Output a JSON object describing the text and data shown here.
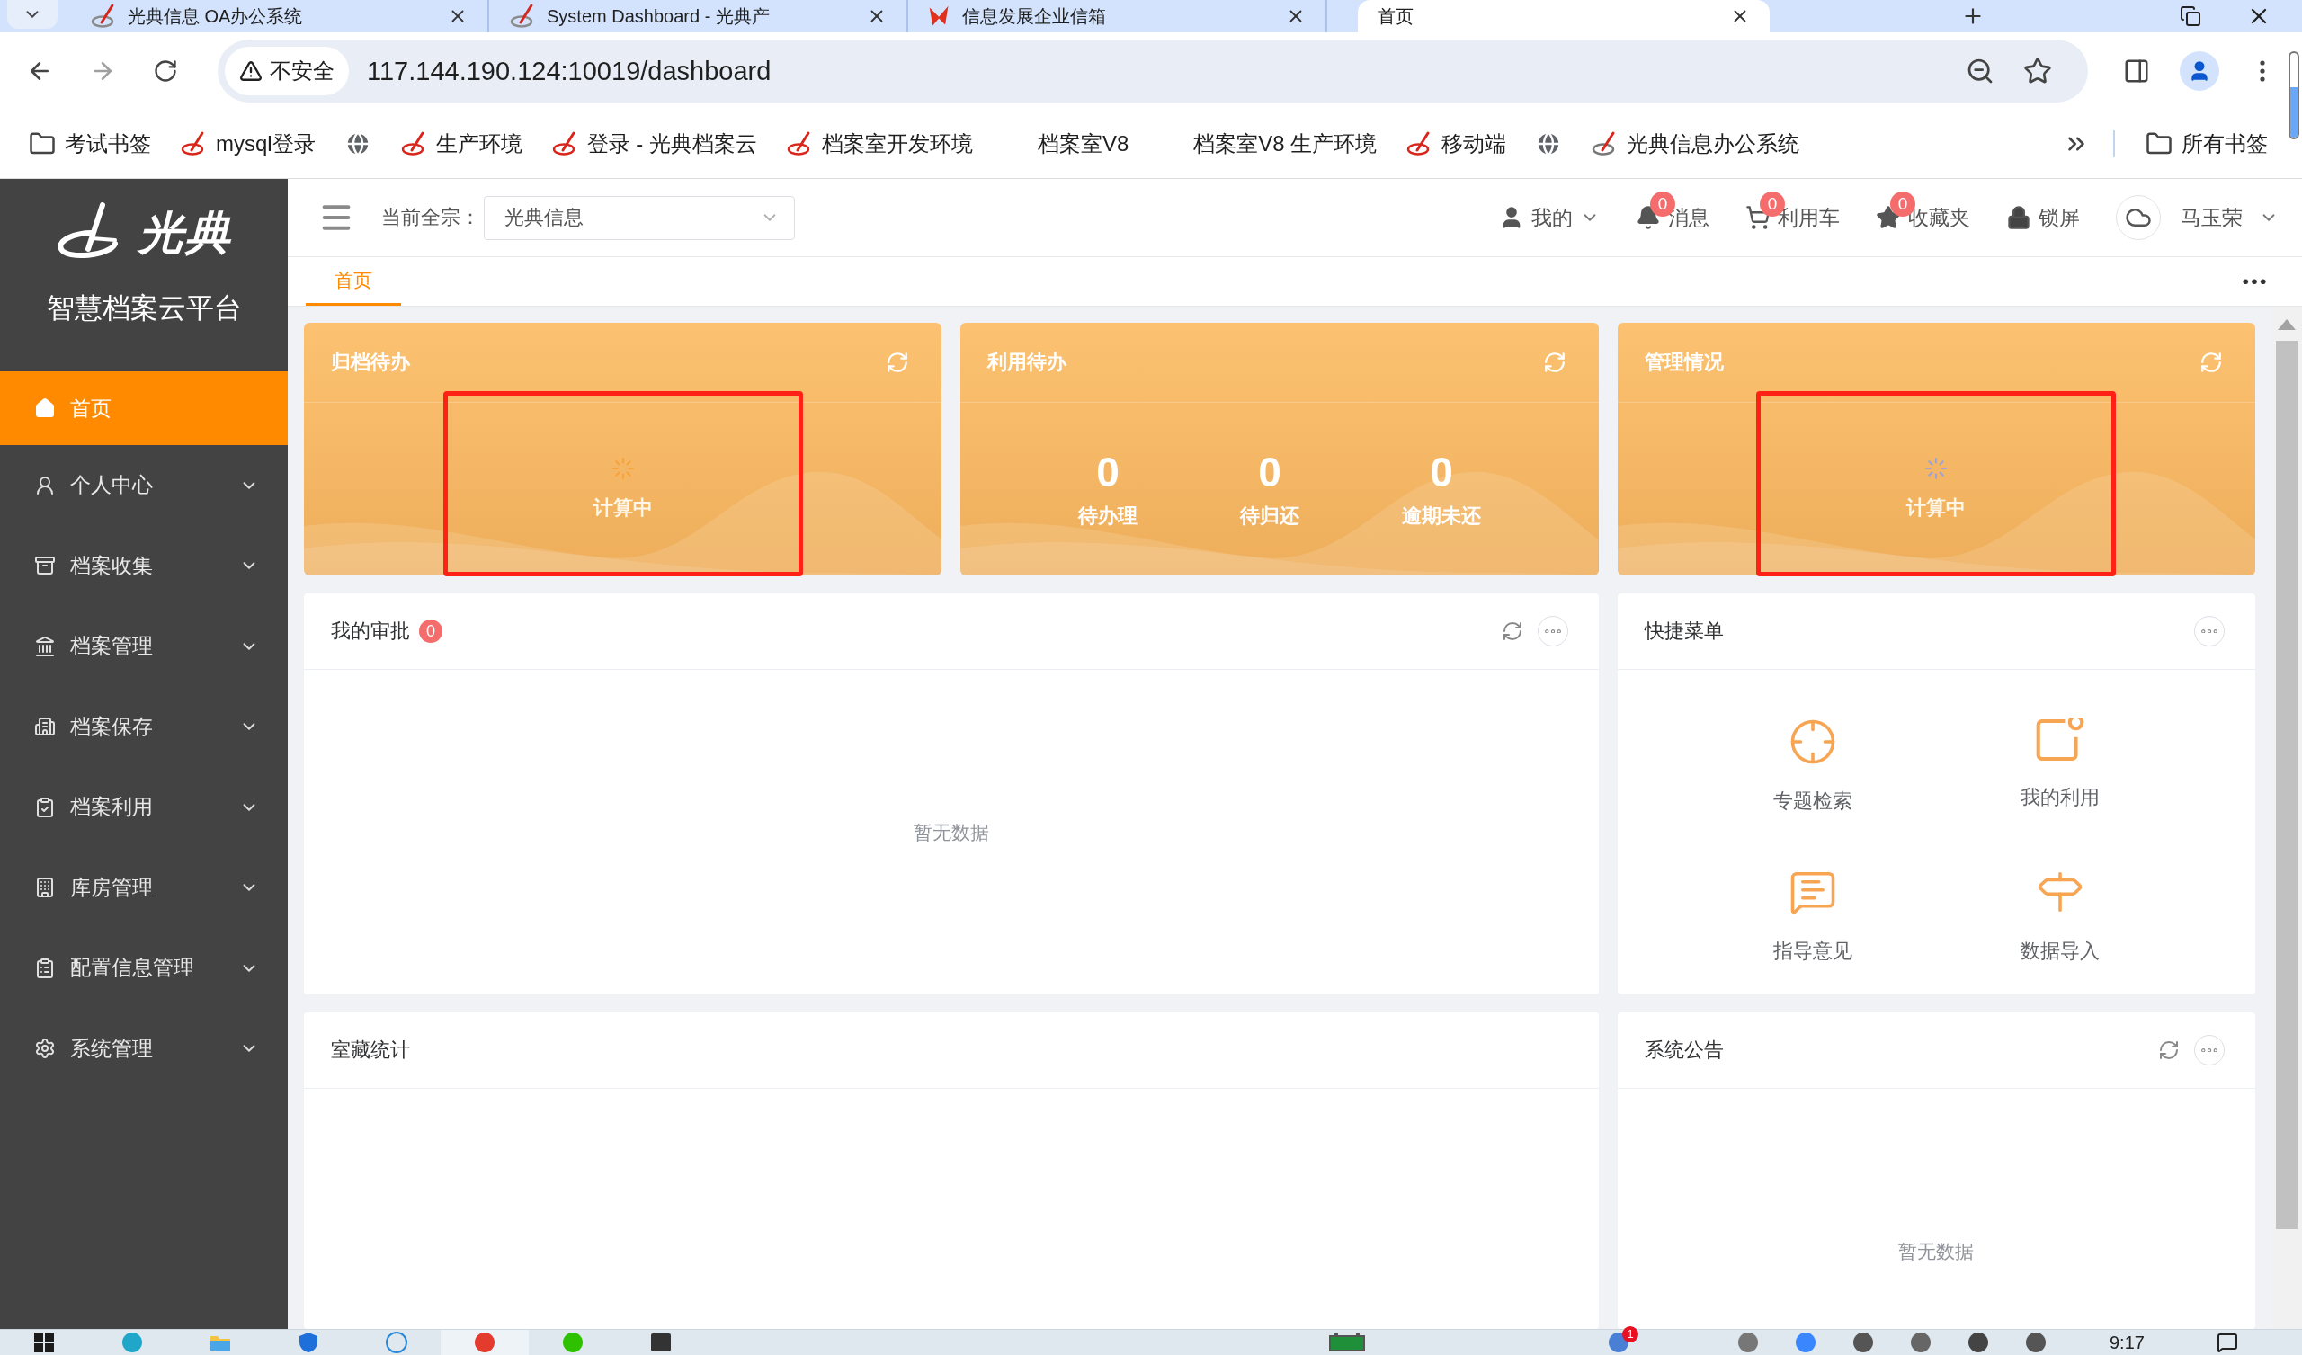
{
  "browser": {
    "tabs": [
      {
        "title": "光典信息 OA办公系统",
        "kind": "logo",
        "selected": false
      },
      {
        "title": "System Dashboard - 光典产",
        "kind": "logo",
        "selected": false
      },
      {
        "title": "信息发展企业信箱",
        "kind": "mark",
        "selected": false
      },
      {
        "title": "首页",
        "kind": "plain",
        "selected": true
      }
    ],
    "toolbar": {
      "forward_disabled": true,
      "security_label": "不安全",
      "url": "117.144.190.124:10019/dashboard"
    },
    "bookmarks": [
      {
        "kind": "folder",
        "label": "考试书签"
      },
      {
        "kind": "logo",
        "label": "mysql登录"
      },
      {
        "kind": "globe"
      },
      {
        "kind": "logo",
        "label": "生产环境"
      },
      {
        "kind": "logo",
        "label": "登录 - 光典档案云"
      },
      {
        "kind": "logo",
        "label": "档案室开发环境"
      },
      {
        "kind": "plain",
        "label": "档案室V8"
      },
      {
        "kind": "plain",
        "label": "档案室V8 生产环境"
      },
      {
        "kind": "logo",
        "label": "移动端"
      },
      {
        "kind": "globe"
      },
      {
        "kind": "ring",
        "label": "光典信息办公系统"
      }
    ],
    "all_bookmarks": "所有书签"
  },
  "sidebar": {
    "logo": "光典",
    "platform": "智慧档案云平台",
    "menu": [
      {
        "label": "首页",
        "kind": "link",
        "selected": true
      },
      {
        "label": "个人中心",
        "kind": "submenu",
        "selected": false,
        "expanded": false
      },
      {
        "label": "档案收集",
        "kind": "submenu",
        "selected": false,
        "expanded": false
      },
      {
        "label": "档案管理",
        "kind": "submenu",
        "selected": false,
        "expanded": false
      },
      {
        "label": "档案保存",
        "kind": "submenu",
        "selected": false,
        "expanded": false
      },
      {
        "label": "档案利用",
        "kind": "submenu",
        "selected": false,
        "expanded": false
      },
      {
        "label": "库房管理",
        "kind": "submenu",
        "selected": false,
        "expanded": false
      },
      {
        "label": "配置信息管理",
        "kind": "submenu",
        "selected": false,
        "expanded": false
      },
      {
        "label": "系统管理",
        "kind": "submenu",
        "selected": false,
        "expanded": false
      }
    ]
  },
  "header": {
    "fonds_label": "当前全宗：",
    "fonds_value": "光典信息",
    "actions": [
      {
        "label": "我的",
        "kind": "menu"
      },
      {
        "label": "消息",
        "kind": "plain",
        "badge": "0"
      },
      {
        "label": "利用车",
        "kind": "plain",
        "badge": "0"
      },
      {
        "label": "收藏夹",
        "kind": "plain",
        "badge": "0"
      },
      {
        "label": "锁屏",
        "kind": "plain"
      }
    ],
    "user": "马玉荣"
  },
  "page_tabs": [
    {
      "label": "首页",
      "selected": true
    }
  ],
  "stat_cards": [
    {
      "title": "归档待办",
      "kind": "loading",
      "loading_text": "计算中",
      "spinner": {
        "color": "#f7a23b"
      },
      "highlighted": true
    },
    {
      "title": "利用待办",
      "kind": "counts",
      "counts": [
        {
          "value": "0",
          "label": "待办理"
        },
        {
          "value": "0",
          "label": "待归还"
        },
        {
          "value": "0",
          "label": "逾期未还"
        }
      ],
      "highlighted": false
    },
    {
      "title": "管理情况",
      "kind": "loading",
      "loading_text": "计算中",
      "spinner": {
        "color": "#9aa3d6"
      },
      "highlighted": true
    }
  ],
  "panels": [
    {
      "title": "我的审批",
      "badge": "0",
      "refresh_button": true,
      "more_button": true,
      "kind": "empty",
      "empty_text": "暂无数据"
    },
    {
      "title": "快捷菜单",
      "refresh_button": false,
      "more_button": true,
      "kind": "shortcuts",
      "shortcuts": [
        "专题检索",
        "我的利用",
        "指导意见",
        "数据导入"
      ]
    },
    {
      "title": "室藏统计",
      "refresh_button": false,
      "more_button": false,
      "kind": "blank"
    },
    {
      "title": "系统公告",
      "refresh_button": true,
      "more_button": true,
      "kind": "empty",
      "empty_text": "暂无数据"
    }
  ],
  "taskbar": {
    "apps": [
      {
        "selected": false
      },
      {
        "selected": false
      },
      {
        "selected": false
      },
      {
        "selected": false
      },
      {
        "selected": false
      },
      {
        "selected": true
      },
      {
        "selected": false
      },
      {
        "selected": false
      }
    ],
    "notification_count": "1",
    "time": "9:17"
  }
}
